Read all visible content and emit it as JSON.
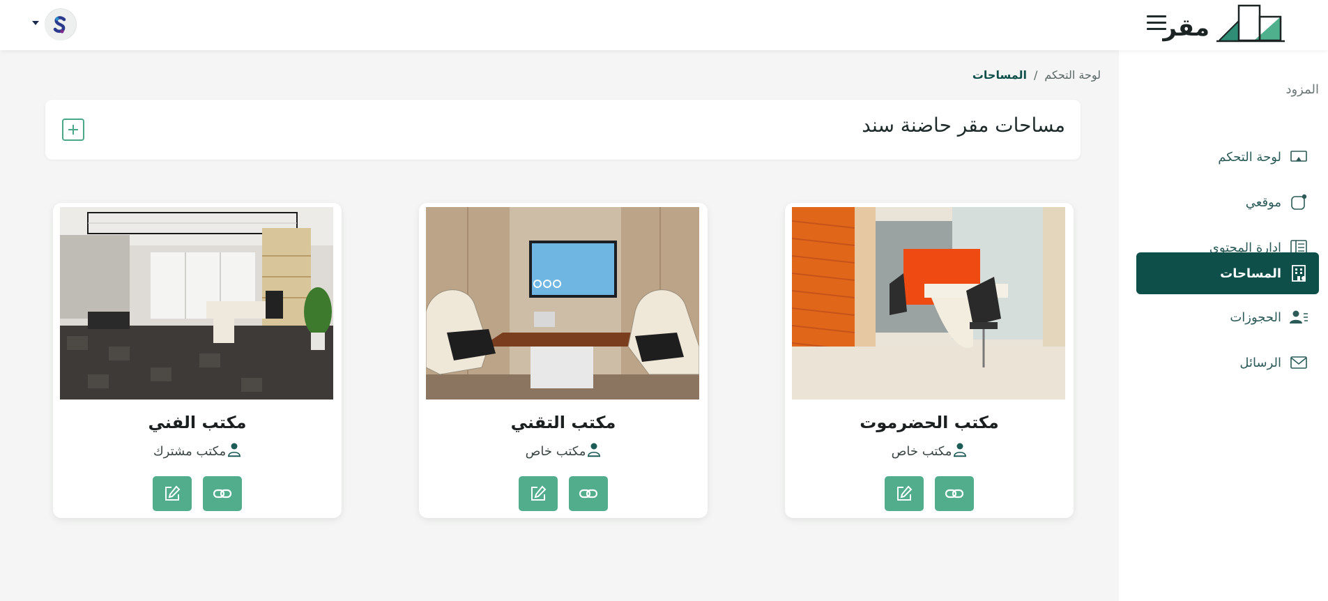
{
  "app": {
    "brand_name": "مقر"
  },
  "sidebar": {
    "heading": "المزود",
    "items": [
      {
        "label": "لوحة التحكم",
        "icon": "monitor-icon",
        "active": false
      },
      {
        "label": "موقعي",
        "icon": "site-icon",
        "active": false
      },
      {
        "label": "ادارة المحتوى",
        "icon": "content-icon",
        "active": false
      },
      {
        "label": "المساحات",
        "icon": "building-icon",
        "active": true
      },
      {
        "label": "الحجوزات",
        "icon": "bookings-icon",
        "active": false
      },
      {
        "label": "الرسائل",
        "icon": "envelope-icon",
        "active": false
      }
    ]
  },
  "breadcrumb": {
    "home": "لوحة التحكم",
    "separator": "/",
    "current": "المساحات"
  },
  "page": {
    "title": "مساحات مقر حاضنة سند"
  },
  "spaces": [
    {
      "name": "مكتب الحضرموت",
      "type": "مكتب خاص"
    },
    {
      "name": "مكتب التقني",
      "type": "مكتب خاص"
    },
    {
      "name": "مكتب الفني",
      "type": "مكتب مشترك"
    }
  ],
  "colors": {
    "primary": "#0e4f4a",
    "button": "#52ad8c",
    "sidebar_text": "#2b5a58"
  }
}
